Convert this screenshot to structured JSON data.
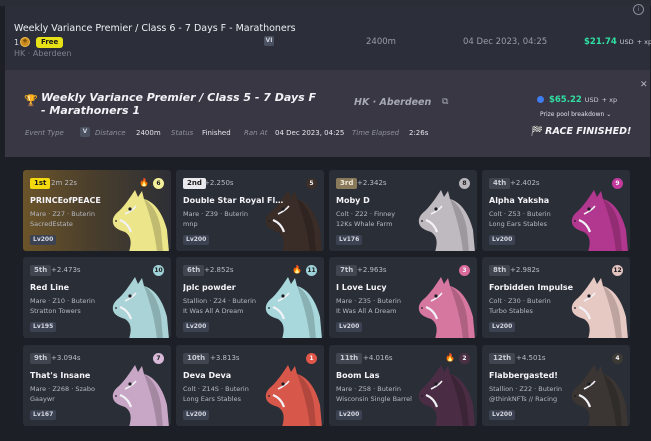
{
  "colors": {
    "prize_green": "#2fe0a3",
    "free_badge": "#e6e217",
    "first_badge": "#f3d90d"
  },
  "prev_race": {
    "title": "Weekly Variance Premier / Class 6 - 7 Days F - Marathoners",
    "entrants_num": "1",
    "free_label": "Free",
    "location": "HK · Aberdeen",
    "distance": "2400m",
    "date": "04 Dec 2023, 04:25",
    "prize": "$21.74",
    "prize_currency": "USD",
    "prize_xp": "+ xp"
  },
  "race": {
    "title": "Weekly Variance Premier / Class 5 - 7 Days F - Marathoners 1",
    "location": "HK · Aberdeen",
    "prize": "$65.22",
    "prize_currency": "USD",
    "prize_xp": "+ xp",
    "breakdown_label": "Prize pool breakdown",
    "finished_label": "RACE FINISHED!",
    "event_type_label": "Event Type",
    "event_type_value": "V",
    "distance_label": "Distance",
    "distance_value": "2400m",
    "status_label": "Status",
    "status_value": "Finished",
    "ran_at_label": "Ran At",
    "ran_at_value": "04 Dec 2023, 04:25",
    "elapsed_label": "Time Elapsed",
    "elapsed_value": "2:26s"
  },
  "results": [
    {
      "rank": "1st",
      "gap": "2m 22s",
      "name": "PRINCEofPEACE",
      "details": "Mare · Z27 · Buterin",
      "owner": "SacredEstate",
      "level": "Lv200",
      "gate": "6",
      "gate_color": "#f4ef9a",
      "flame": true,
      "horse_color": "#ece58a"
    },
    {
      "rank": "2nd",
      "gap": "+2.250s",
      "name": "Double Star Royal Flush",
      "details": "Mare · Z39 · Buterin",
      "owner": "mnp",
      "level": "Lv200",
      "gate": "5",
      "gate_color": "#3b2f28",
      "flame": false,
      "horse_color": "#3a2c27"
    },
    {
      "rank": "3rd",
      "gap": "+2.342s",
      "name": "Moby D",
      "details": "Colt · Z22 · Finney",
      "owner": "12Ks Whale Farm",
      "level": "Lv176",
      "gate": "8",
      "gate_color": "#b9b6bc",
      "flame": false,
      "horse_color": "#bfbac0"
    },
    {
      "rank": "4th",
      "gap": "+2.402s",
      "name": "Alpha Yaksha",
      "details": "Colt · Z53 · Buterin",
      "owner": "Long Ears Stables",
      "level": "Lv200",
      "gate": "9",
      "gate_color": "#c23a9c",
      "flame": false,
      "horse_color": "#b2378e"
    },
    {
      "rank": "5th",
      "gap": "+2.473s",
      "name": "Red Line",
      "details": "Mare · Z10 · Buterin",
      "owner": "Stratton Towers",
      "level": "Lv195",
      "gate": "10",
      "gate_color": "#9fd2d8",
      "flame": false,
      "horse_color": "#a9d3d6"
    },
    {
      "rank": "6th",
      "gap": "+2.852s",
      "name": "Jplc powder",
      "details": "Stallion · Z24 · Buterin",
      "owner": "It Was All A Dream",
      "level": "Lv200",
      "gate": "11",
      "gate_color": "#9fd2d8",
      "flame": true,
      "horse_color": "#a8d8dc"
    },
    {
      "rank": "7th",
      "gap": "+2.963s",
      "name": "I Love Lucy",
      "details": "Mare · Z35 · Buterin",
      "owner": "It Was All A Dream",
      "level": "Lv200",
      "gate": "3",
      "gate_color": "#d96b9a",
      "flame": false,
      "horse_color": "#d6779f"
    },
    {
      "rank": "8th",
      "gap": "+2.982s",
      "name": "Forbidden Impulse",
      "details": "Colt · Z30 · Buterin",
      "owner": "Turbo Stables",
      "level": "Lv200",
      "gate": "12",
      "gate_color": "#e2c3c0",
      "flame": false,
      "horse_color": "#e7c9c3"
    },
    {
      "rank": "9th",
      "gap": "+3.094s",
      "name": "That's Insane",
      "details": "Mare · Z268 · Szabo",
      "owner": "Gaaywr",
      "level": "Lv167",
      "gate": "7",
      "gate_color": "#d8b9d9",
      "flame": false,
      "horse_color": "#c8a6c6"
    },
    {
      "rank": "10th",
      "gap": "+3.813s",
      "name": "Deva Deva",
      "details": "Colt · Z14S · Buterin",
      "owner": "Long Ears Stables",
      "level": "Lv200",
      "gate": "1",
      "gate_color": "#e0574a",
      "flame": false,
      "horse_color": "#d8574b"
    },
    {
      "rank": "11th",
      "gap": "+4.016s",
      "name": "Boom Las",
      "details": "Mare · Z58 · Buterin",
      "owner": "Wisconsin Single Barrel",
      "level": "Lv200",
      "gate": "2",
      "gate_color": "#4a2f45",
      "flame": true,
      "horse_color": "#4a2d44"
    },
    {
      "rank": "12th",
      "gap": "+4.501s",
      "name": "Flabbergasted!",
      "details": "Stallion · Z22 · Buterin",
      "owner": "@thinkNFTs // Racing",
      "level": "Lv200",
      "gate": "4",
      "gate_color": "#3d3a36",
      "flame": false,
      "horse_color": "#3b3633"
    }
  ]
}
